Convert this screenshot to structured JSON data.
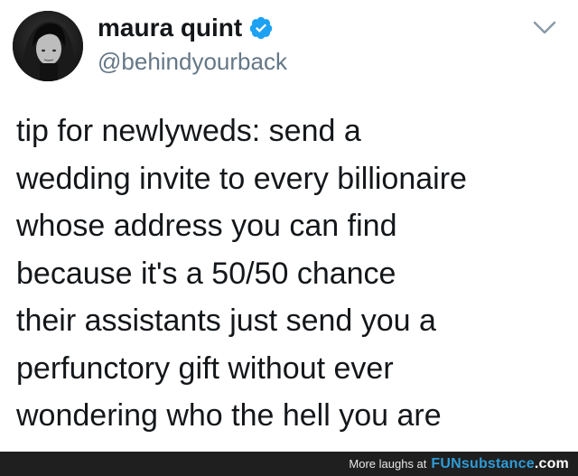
{
  "tweet": {
    "author": {
      "display_name": "maura quint",
      "handle": "@behindyourback",
      "verified": true
    },
    "text_lines": [
      "tip for newlyweds: send a",
      "wedding invite to every billionaire",
      "whose address you can find",
      "because it's a 50/50 chance",
      "their assistants just send you a",
      "perfunctory gift without ever",
      "wondering who the hell you are"
    ],
    "menu_icon": "chevron-down-icon",
    "verified_icon": "verified-badge-icon",
    "colors": {
      "verified": "#1da1f2",
      "handle": "#657786",
      "text": "#14171a"
    }
  },
  "footer": {
    "caption": "More laughs at",
    "brand_main": "FUN",
    "brand_rest": "substance",
    "brand_suffix": ".com",
    "colors": {
      "background": "#1f1f1f",
      "brand": "#2f9bd6"
    }
  }
}
